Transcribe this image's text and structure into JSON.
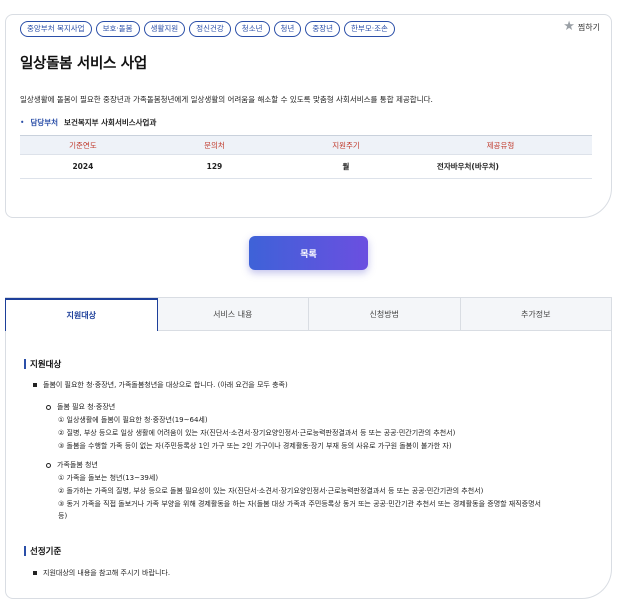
{
  "tags": [
    "중앙부처 복지사업",
    "보호·돌봄",
    "생활지원",
    "정신건강",
    "청소년",
    "청년",
    "중장년",
    "한부모·조손"
  ],
  "bookmark_label": "찜하기",
  "title": "일상돌봄 서비스 사업",
  "description": "일상생활에 돌봄이 필요한 중장년과 가족돌봄청년에게 일상생활의 어려움을 해소할 수 있도록 맞춤형 사회서비스를 통합 제공합니다.",
  "department": {
    "label": "담당부처",
    "value": "보건복지부 사회서비스사업과"
  },
  "info_table": {
    "headers": [
      "기준연도",
      "문의처",
      "지원주기",
      "제공유형"
    ],
    "row": [
      "2024",
      "129",
      "월",
      "전자바우처(바우처)"
    ]
  },
  "list_button": "목록",
  "tabs": [
    "지원대상",
    "서비스 내용",
    "신청방법",
    "추가정보"
  ],
  "support_target": {
    "heading": "지원대상",
    "main_item": "돌봄이 필요한 청·중장년, 가족돌봄청년을 대상으로 합니다. (아래 요건을 모두 충족)",
    "group1": {
      "title": "돌봄 필요 청·중장년",
      "items": [
        "① 일상생활에 돌봄이 필요한 청·중장년(19~64세)",
        "② 질병, 부상 등으로 일상 생활에 어려움이 있는 자(진단서·소견서·장기요양인정서·근로능력판정결과서 등 또는 공공·민간기관의 추천서)",
        "③ 돌봄을 수행할 가족 등이 없는 자(주민등록상 1인 가구 또는 2인 가구이나 경제활동·장기 부재 등의 사유로 가구원 돌봄이 불가한 자)"
      ]
    },
    "group2": {
      "title": "가족돌봄 청년",
      "items": [
        "① 가족을 돌보는 청년(13~39세)",
        "② 돌가하는 가족의 질병, 부상 등으로 돌봄 필요성이 있는 자(진단서·소견서·장기요양인정서·근로능력판정결과서 등 또는 공공·민간기관의 추천서)",
        "③ 동거 가족을 직접 돌보거나 가족 부양을 위해 경제활동을 하는 자(돌봄 대상 가족과 주민등록상 동거 또는 공공·민간기관 추천서 또는 경제활동을 증명할 재직증명서",
        "등)"
      ]
    }
  },
  "selection_criteria": {
    "heading": "선정기준",
    "item": "지원대상의 내용을 참고해 주시기 바랍니다."
  },
  "colors": {
    "accent": "#2b4fa8",
    "button_start": "#3e62d8",
    "button_end": "#6b4fe0",
    "header_text": "#c0392b"
  }
}
